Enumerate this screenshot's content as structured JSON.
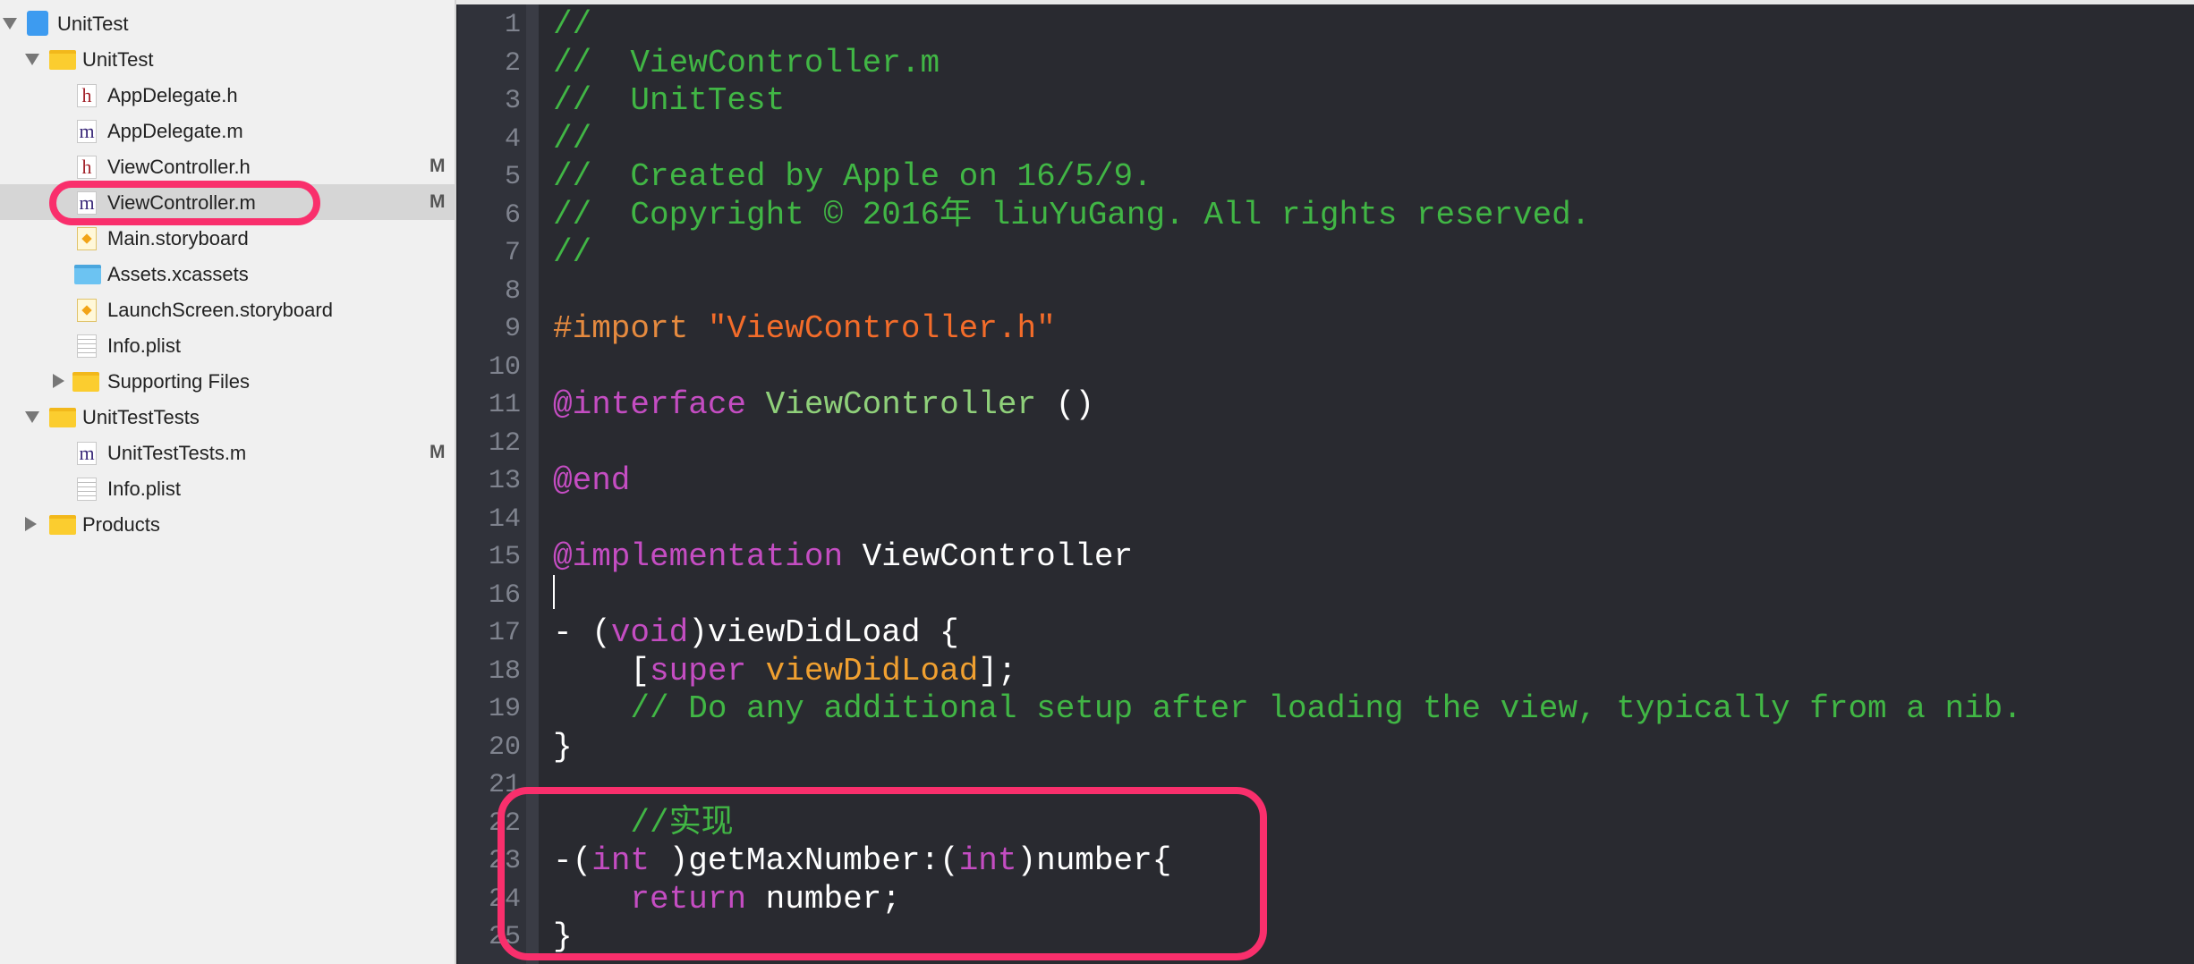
{
  "navigator": {
    "items": [
      {
        "label": "UnitTest",
        "icon": "project-icon",
        "level": 0,
        "disclosure": "open",
        "badge": ""
      },
      {
        "label": "UnitTest",
        "icon": "folder-icon",
        "level": 1,
        "disclosure": "open",
        "badge": ""
      },
      {
        "label": "AppDelegate.h",
        "icon": "header-file-icon",
        "level": 2,
        "badge": ""
      },
      {
        "label": "AppDelegate.m",
        "icon": "objc-file-icon",
        "level": 2,
        "badge": ""
      },
      {
        "label": "ViewController.h",
        "icon": "header-file-icon",
        "level": 2,
        "badge": "M"
      },
      {
        "label": "ViewController.m",
        "icon": "objc-file-icon",
        "level": 2,
        "badge": "M",
        "selected": true
      },
      {
        "label": "Main.storyboard",
        "icon": "storyboard-icon",
        "level": 2,
        "badge": ""
      },
      {
        "label": "Assets.xcassets",
        "icon": "asset-catalog-icon",
        "level": 2,
        "badge": ""
      },
      {
        "label": "LaunchScreen.storyboard",
        "icon": "storyboard-icon",
        "level": 2,
        "badge": ""
      },
      {
        "label": "Info.plist",
        "icon": "plist-icon",
        "level": 2,
        "badge": ""
      },
      {
        "label": "Supporting Files",
        "icon": "folder-icon",
        "level": 2,
        "disclosure": "closed",
        "badge": ""
      },
      {
        "label": "UnitTestTests",
        "icon": "folder-icon",
        "level": 1,
        "disclosure": "open",
        "badge": ""
      },
      {
        "label": "UnitTestTests.m",
        "icon": "objc-file-icon",
        "level": 2,
        "badge": "M"
      },
      {
        "label": "Info.plist",
        "icon": "plist-icon",
        "level": 2,
        "badge": ""
      },
      {
        "label": "Products",
        "icon": "folder-icon",
        "level": 1,
        "disclosure": "closed",
        "badge": ""
      }
    ]
  },
  "colors": {
    "highlight": "#f92f6c",
    "comment": "#41b645",
    "keyword": "#c44dc2",
    "preprocessor": "#e58a3f",
    "string": "#f36c2a",
    "editor_bg": "#292a30"
  },
  "editor": {
    "lines": [
      {
        "n": "1",
        "tokens": [
          [
            "comment",
            "//"
          ]
        ]
      },
      {
        "n": "2",
        "tokens": [
          [
            "comment",
            "//  ViewController.m"
          ]
        ]
      },
      {
        "n": "3",
        "tokens": [
          [
            "comment",
            "//  UnitTest"
          ]
        ]
      },
      {
        "n": "4",
        "tokens": [
          [
            "comment",
            "//"
          ]
        ]
      },
      {
        "n": "5",
        "tokens": [
          [
            "comment",
            "//  Created by Apple on 16/5/9."
          ]
        ]
      },
      {
        "n": "6",
        "tokens": [
          [
            "comment",
            "//  Copyright © 2016年 liuYuGang. All rights reserved."
          ]
        ]
      },
      {
        "n": "7",
        "tokens": [
          [
            "comment",
            "//"
          ]
        ]
      },
      {
        "n": "8",
        "tokens": []
      },
      {
        "n": "9",
        "tokens": [
          [
            "pre",
            "#import "
          ],
          [
            "str",
            "\"ViewController.h\""
          ]
        ]
      },
      {
        "n": "10",
        "tokens": []
      },
      {
        "n": "11",
        "tokens": [
          [
            "kw",
            "@interface"
          ],
          [
            "plain",
            " "
          ],
          [
            "cls",
            "ViewController"
          ],
          [
            "plain",
            " ()"
          ]
        ]
      },
      {
        "n": "12",
        "tokens": []
      },
      {
        "n": "13",
        "tokens": [
          [
            "kw",
            "@end"
          ]
        ]
      },
      {
        "n": "14",
        "tokens": []
      },
      {
        "n": "15",
        "tokens": [
          [
            "kw",
            "@implementation"
          ],
          [
            "plain",
            " ViewController"
          ]
        ]
      },
      {
        "n": "16",
        "tokens": []
      },
      {
        "n": "17",
        "tokens": [
          [
            "plain",
            "- ("
          ],
          [
            "kw",
            "void"
          ],
          [
            "plain",
            ")viewDidLoad {"
          ]
        ]
      },
      {
        "n": "18",
        "tokens": [
          [
            "plain",
            "    ["
          ],
          [
            "kw",
            "super"
          ],
          [
            "plain",
            " "
          ],
          [
            "meth",
            "viewDidLoad"
          ],
          [
            "plain",
            "];"
          ]
        ]
      },
      {
        "n": "19",
        "tokens": [
          [
            "plain",
            "    "
          ],
          [
            "comment",
            "// Do any additional setup after loading the view, typically from a nib."
          ]
        ]
      },
      {
        "n": "20",
        "tokens": [
          [
            "plain",
            "}"
          ]
        ]
      },
      {
        "n": "21",
        "tokens": []
      },
      {
        "n": "22",
        "tokens": [
          [
            "plain",
            "    "
          ],
          [
            "comment",
            "//实现"
          ]
        ]
      },
      {
        "n": "23",
        "tokens": [
          [
            "plain",
            "-("
          ],
          [
            "kw",
            "int"
          ],
          [
            "plain",
            " )getMaxNumber:("
          ],
          [
            "kw",
            "int"
          ],
          [
            "plain",
            ")number{"
          ]
        ]
      },
      {
        "n": "24",
        "tokens": [
          [
            "plain",
            "    "
          ],
          [
            "kw",
            "return"
          ],
          [
            "plain",
            " number;"
          ]
        ]
      },
      {
        "n": "25",
        "tokens": [
          [
            "plain",
            "}"
          ]
        ]
      }
    ]
  }
}
